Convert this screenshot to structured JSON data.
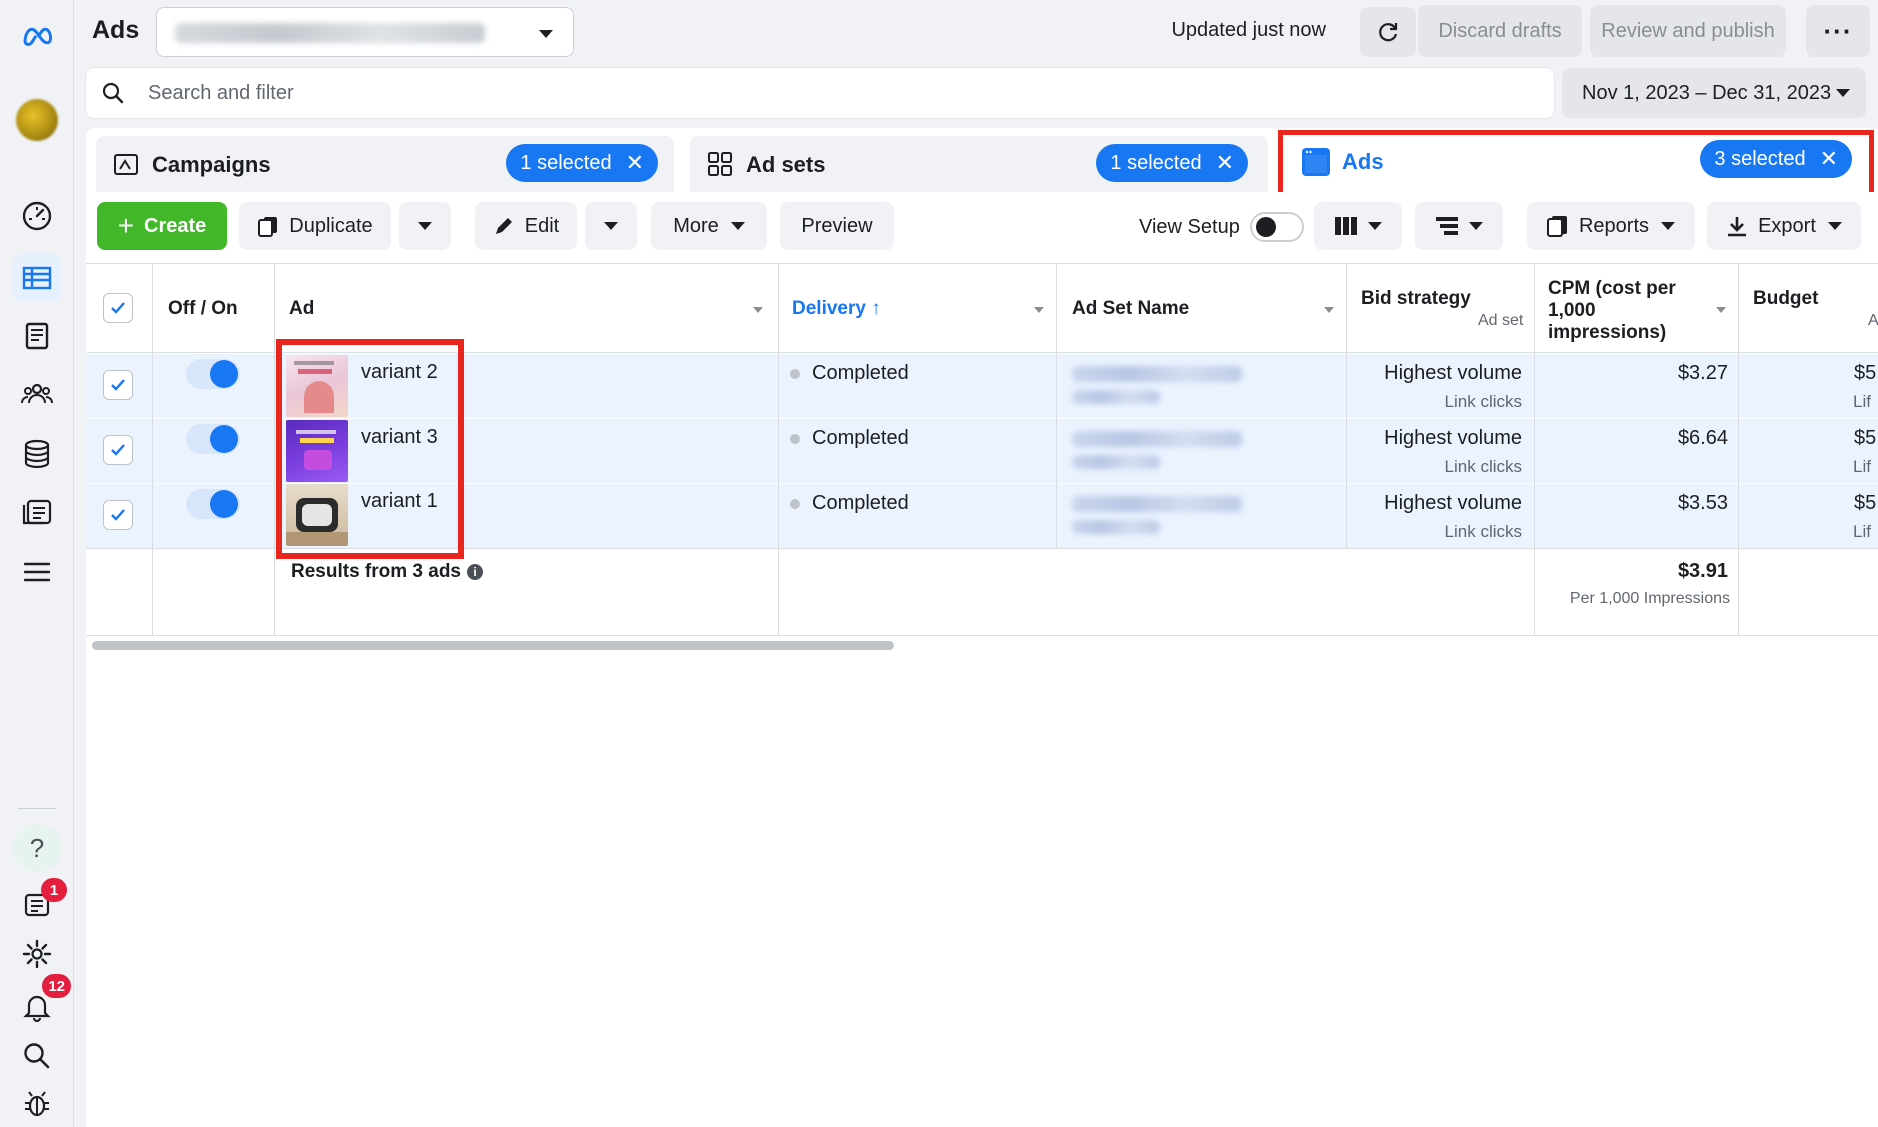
{
  "header": {
    "app_title": "Ads",
    "updated_text": "Updated just now",
    "discard_label": "Discard drafts",
    "review_label": "Review and publish",
    "more_label": "···"
  },
  "search": {
    "placeholder": "Search and filter"
  },
  "date_range": {
    "label": "Nov 1, 2023 – Dec 31, 2023"
  },
  "rail": {
    "help_label": "?",
    "notifications_badge": "1",
    "alerts_badge": "12"
  },
  "levels": {
    "campaigns": {
      "label": "Campaigns",
      "selected": "1 selected"
    },
    "adsets": {
      "label": "Ad sets",
      "selected": "1 selected"
    },
    "ads": {
      "label": "Ads",
      "selected": "3 selected"
    }
  },
  "toolbar": {
    "create_label": "Create",
    "duplicate_label": "Duplicate",
    "edit_label": "Edit",
    "more_label": "More",
    "preview_label": "Preview",
    "view_setup_label": "View Setup",
    "reports_label": "Reports",
    "export_label": "Export"
  },
  "table": {
    "headers": {
      "off_on": "Off / On",
      "ad": "Ad",
      "delivery": "Delivery ↑",
      "ad_set_name": "Ad Set Name",
      "bid_strategy": "Bid strategy",
      "bid_strategy_sub": "Ad set",
      "cpm": "CPM (cost per 1,000 impressions)",
      "budget": "Budget",
      "budget_sub": "A"
    },
    "rows": [
      {
        "name": "variant 2",
        "delivery": "Completed",
        "bid": "Highest volume",
        "bid_sub": "Link clicks",
        "cpm": "$3.27",
        "budget": "$5",
        "budget_sub": "Lif"
      },
      {
        "name": "variant 3",
        "delivery": "Completed",
        "bid": "Highest volume",
        "bid_sub": "Link clicks",
        "cpm": "$6.64",
        "budget": "$5",
        "budget_sub": "Lif"
      },
      {
        "name": "variant 1",
        "delivery": "Completed",
        "bid": "Highest volume",
        "bid_sub": "Link clicks",
        "cpm": "$3.53",
        "budget": "$5",
        "budget_sub": "Lif"
      }
    ],
    "summary": {
      "label": "Results from 3 ads",
      "cpm": "$3.91",
      "cpm_sub": "Per 1,000 Impressions"
    }
  },
  "colors": {
    "accent": "#1877f2",
    "create_green": "#42b72a",
    "highlight_red": "#e8261d",
    "selected_row": "#ebf3ff"
  }
}
